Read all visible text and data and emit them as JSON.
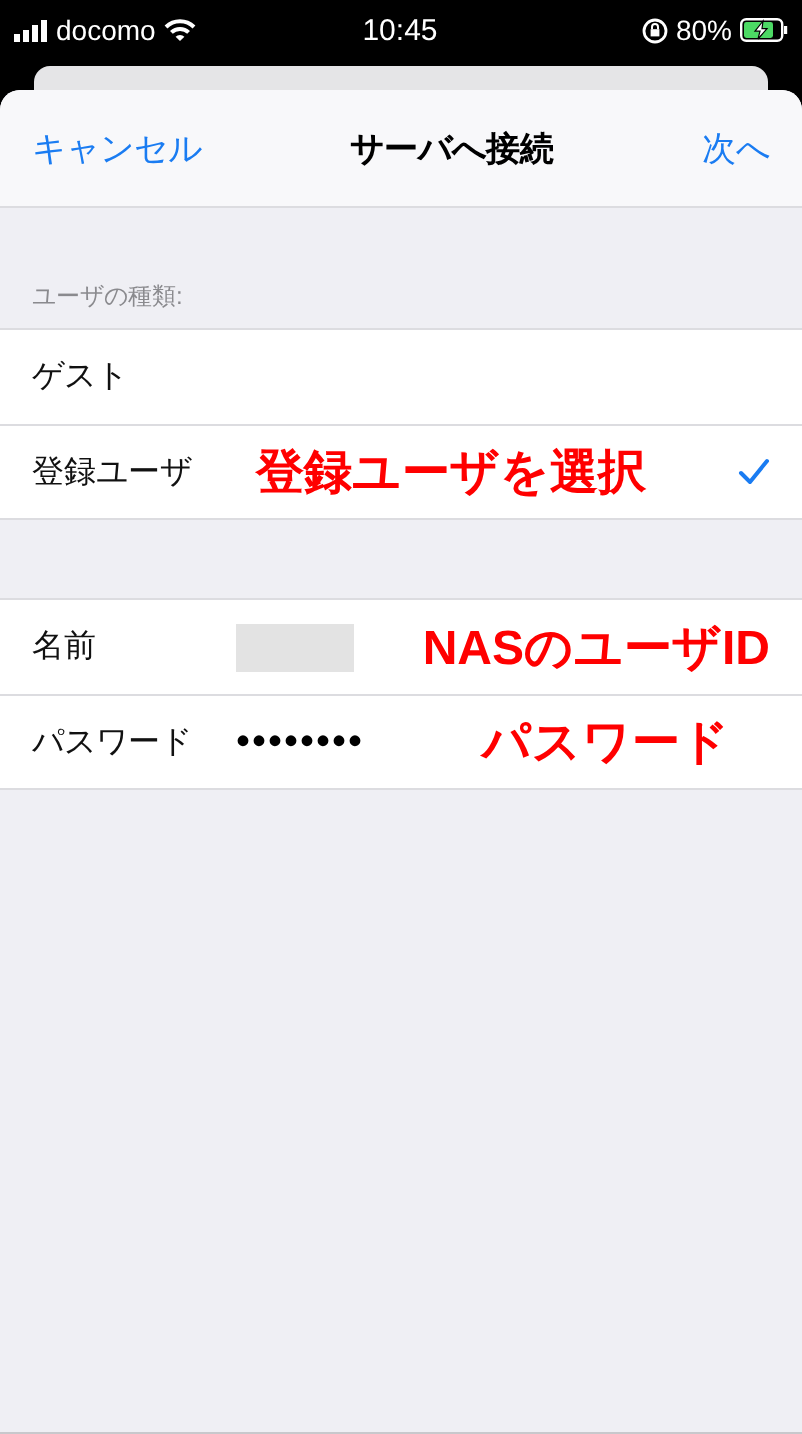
{
  "status_bar": {
    "carrier": "docomo",
    "time": "10:45",
    "battery": "80%"
  },
  "nav": {
    "cancel": "キャンセル",
    "title": "サーバへ接続",
    "next": "次へ"
  },
  "user_type": {
    "header": "ユーザの種類:",
    "options": [
      {
        "label": "ゲスト",
        "selected": false
      },
      {
        "label": "登録ユーザ",
        "selected": true,
        "annotation": "登録ユーザを選択"
      }
    ]
  },
  "credentials": [
    {
      "kind": "redacted",
      "label": "名前",
      "annotation": "NASのユーザID"
    },
    {
      "kind": "password",
      "label": "パスワード",
      "value": "••••••••",
      "annotation": "パスワード"
    }
  ]
}
